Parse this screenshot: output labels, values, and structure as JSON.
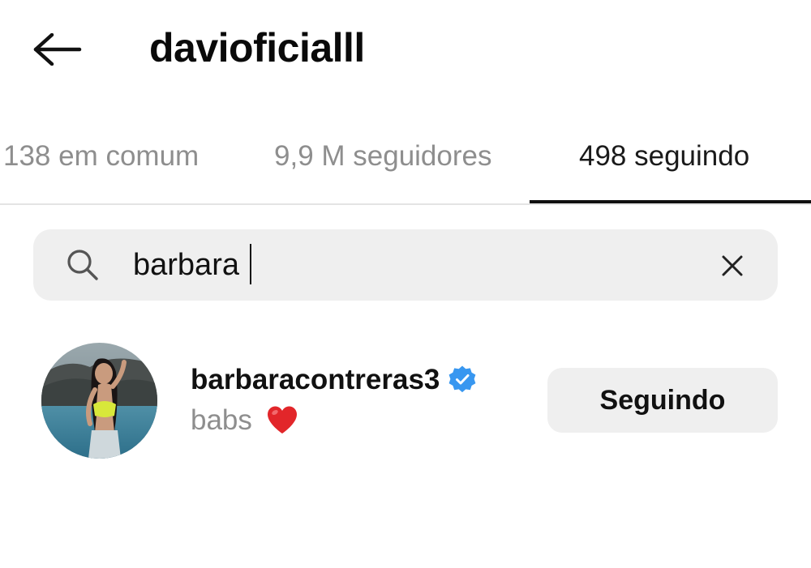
{
  "header": {
    "title": "davioficialll",
    "back_icon": "arrow-left-icon"
  },
  "tabs": [
    {
      "label": "138 em comum",
      "active": false
    },
    {
      "label": "9,9 M seguidores",
      "active": false
    },
    {
      "label": "498 seguindo",
      "active": true
    }
  ],
  "search": {
    "value": "barbara",
    "search_icon": "search-icon",
    "clear_icon": "close-icon"
  },
  "results": [
    {
      "username": "barbaracontreras3",
      "verified": true,
      "subtitle": "babs",
      "subtitle_emoji": "red-heart-icon",
      "action_label": "Seguindo"
    }
  ],
  "colors": {
    "text_primary": "#111111",
    "text_secondary": "#8e8e8e",
    "surface": "#efefef",
    "verified_blue": "#3897f0",
    "heart_red": "#e2262a"
  }
}
